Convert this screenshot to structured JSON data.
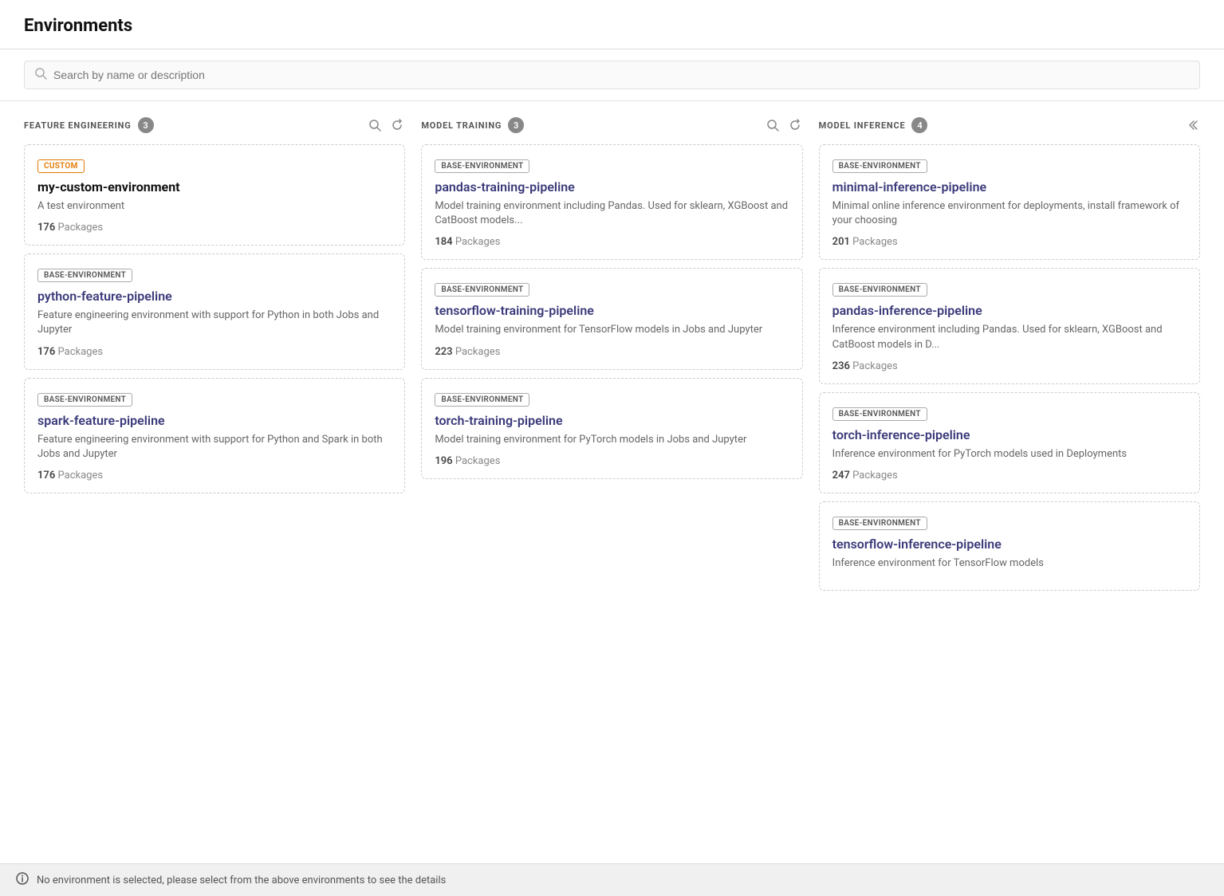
{
  "header": {
    "title": "Environments"
  },
  "search": {
    "placeholder": "Search by name or description"
  },
  "columns": [
    {
      "id": "feature-engineering",
      "title": "FEATURE ENGINEERING",
      "count": 3,
      "actions": [
        "search",
        "refresh"
      ],
      "cards": [
        {
          "badge": "CUSTOM",
          "badge_type": "custom",
          "name": "my-custom-environment",
          "name_style": "bold",
          "desc": "A test environment",
          "packages": 176
        },
        {
          "badge": "BASE-ENVIRONMENT",
          "badge_type": "base",
          "name": "python-feature-pipeline",
          "name_style": "normal",
          "desc": "Feature engineering environment with support for Python in both Jobs and Jupyter",
          "packages": 176
        },
        {
          "badge": "BASE-ENVIRONMENT",
          "badge_type": "base",
          "name": "spark-feature-pipeline",
          "name_style": "normal",
          "desc": "Feature engineering environment with support for Python and Spark in both Jobs and Jupyter",
          "packages": 176
        }
      ]
    },
    {
      "id": "model-training",
      "title": "MODEL TRAINING",
      "count": 3,
      "actions": [
        "search",
        "refresh"
      ],
      "cards": [
        {
          "badge": "BASE-ENVIRONMENT",
          "badge_type": "base",
          "name": "pandas-training-pipeline",
          "name_style": "normal",
          "desc": "Model training environment including Pandas. Used for sklearn, XGBoost and CatBoost models...",
          "packages": 184
        },
        {
          "badge": "BASE-ENVIRONMENT",
          "badge_type": "base",
          "name": "tensorflow-training-pipeline",
          "name_style": "normal",
          "desc": "Model training environment for TensorFlow models in Jobs and Jupyter",
          "packages": 223
        },
        {
          "badge": "BASE-ENVIRONMENT",
          "badge_type": "base",
          "name": "torch-training-pipeline",
          "name_style": "normal",
          "desc": "Model training environment for PyTorch models in Jobs and Jupyter",
          "packages": 196
        }
      ]
    },
    {
      "id": "model-inference",
      "title": "MODEL INFERENCE",
      "count": 4,
      "actions": [
        "back"
      ],
      "cards": [
        {
          "badge": "BASE-ENVIRONMENT",
          "badge_type": "base",
          "name": "minimal-inference-pipeline",
          "name_style": "normal",
          "desc": "Minimal online inference environment for deployments, install framework of your choosing",
          "packages": 201
        },
        {
          "badge": "BASE-ENVIRONMENT",
          "badge_type": "base",
          "name": "pandas-inference-pipeline",
          "name_style": "normal",
          "desc": "Inference environment including Pandas. Used for sklearn, XGBoost and CatBoost models in D...",
          "packages": 236
        },
        {
          "badge": "BASE-ENVIRONMENT",
          "badge_type": "base",
          "name": "torch-inference-pipeline",
          "name_style": "normal",
          "desc": "Inference environment for PyTorch models used in Deployments",
          "packages": 247
        },
        {
          "badge": "BASE-ENVIRONMENT",
          "badge_type": "base",
          "name": "tensorflow-inference-pipeline",
          "name_style": "normal",
          "desc": "Inference environment for TensorFlow models",
          "packages": null
        }
      ]
    }
  ],
  "status_bar": {
    "message": "No environment is selected, please select from the above environments to see the details"
  },
  "labels": {
    "packages": "Packages"
  }
}
